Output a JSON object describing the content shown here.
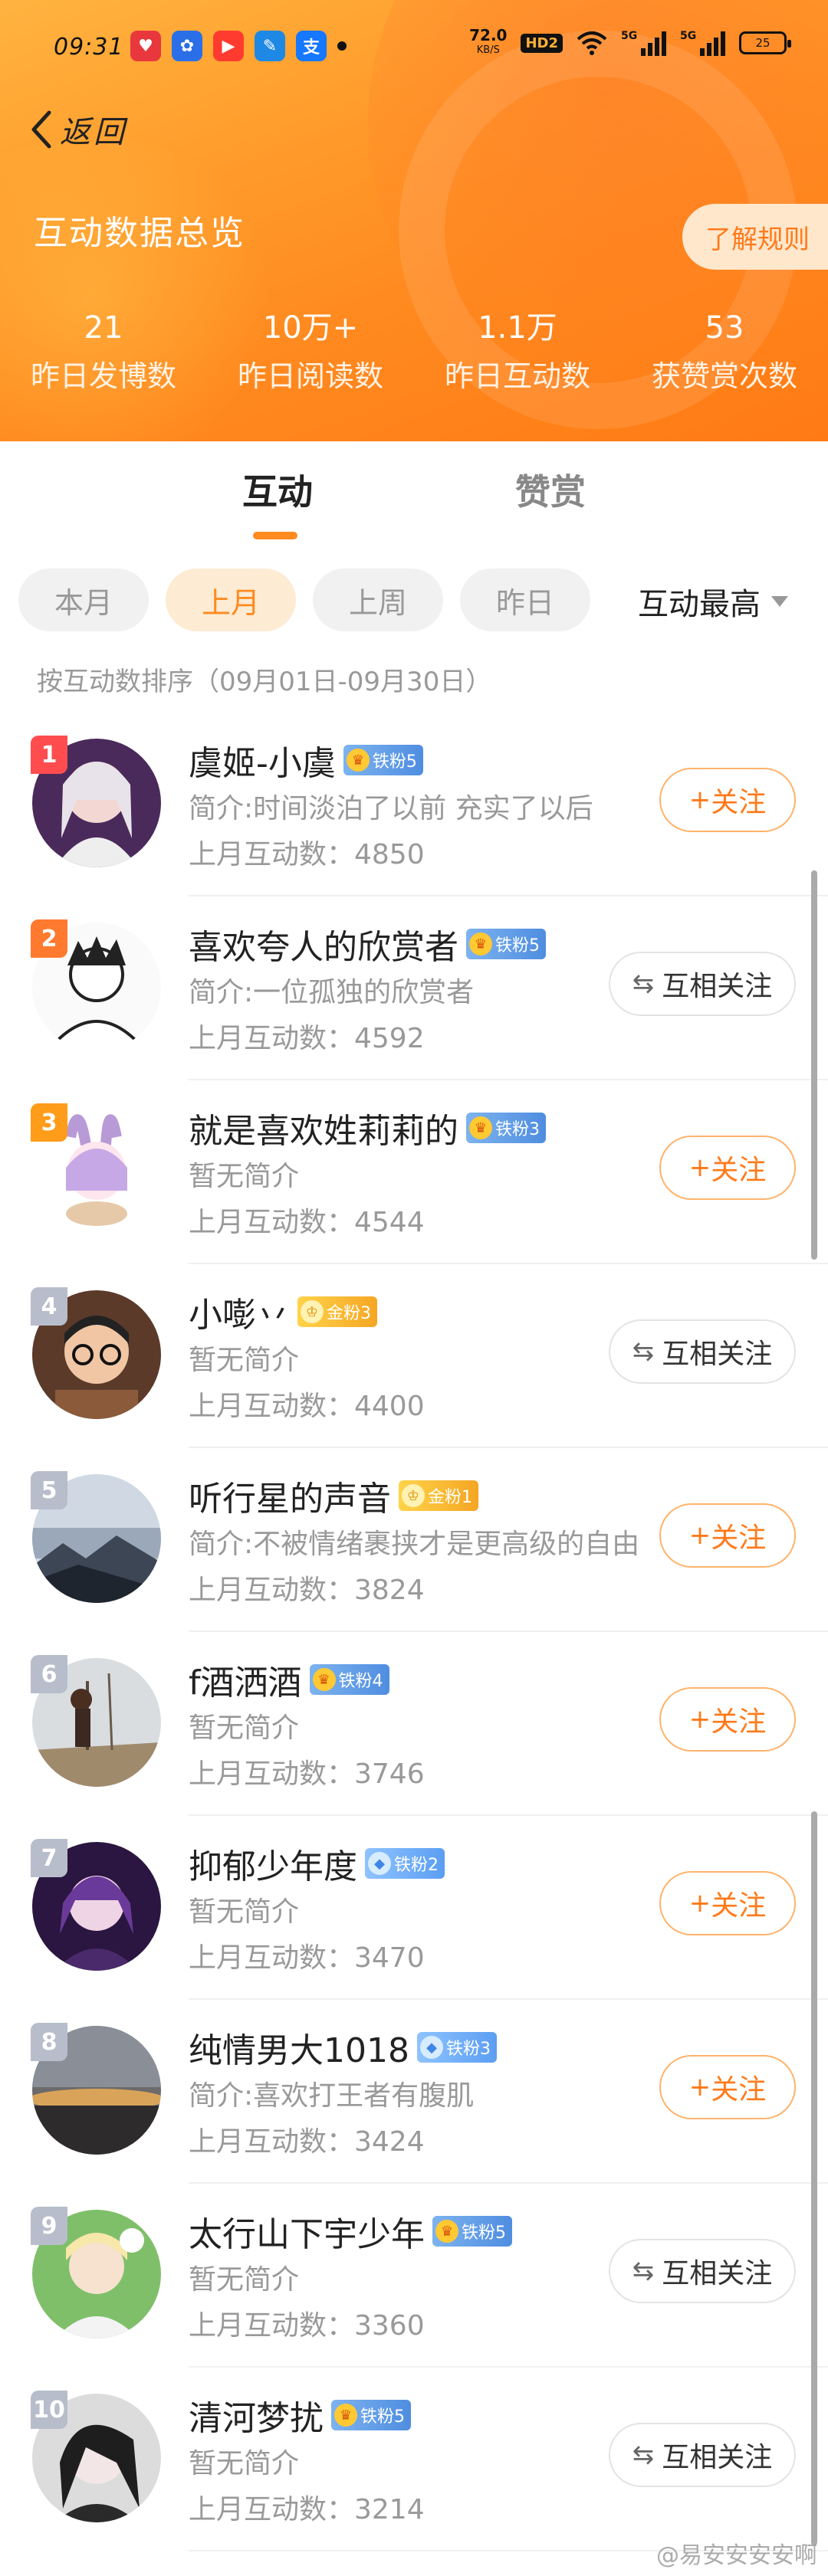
{
  "status_bar": {
    "time": "09:31",
    "network_speed": "72.0",
    "network_unit": "KB/S",
    "hd_label": "HD2",
    "signal_label": "5G",
    "battery": "25"
  },
  "header": {
    "back_label": "返回",
    "title": "互动数据总览",
    "rules_button": "了解规则",
    "stats": [
      {
        "value": "21",
        "label": "昨日发博数"
      },
      {
        "value": "10万+",
        "label": "昨日阅读数"
      },
      {
        "value": "1.1万",
        "label": "昨日互动数"
      },
      {
        "value": "53",
        "label": "获赞赏次数"
      }
    ]
  },
  "tabs": [
    {
      "label": "互动",
      "active": true
    },
    {
      "label": "赞赏",
      "active": false
    }
  ],
  "filters": {
    "chips": [
      {
        "label": "本月",
        "active": false
      },
      {
        "label": "上月",
        "active": true
      },
      {
        "label": "上周",
        "active": false
      },
      {
        "label": "昨日",
        "active": false
      }
    ],
    "sort_label": "互动最高",
    "sort_note": "按互动数排序（09月01日-09月30日）"
  },
  "users": [
    {
      "rank": "1",
      "name": "虞姬-小虞",
      "badge": "铁粉5",
      "badge_type": "iron",
      "intro": "简介:时间淡泊了以前 充实了以后",
      "count": "上月互动数：4850",
      "action": "关注",
      "action_type": "follow"
    },
    {
      "rank": "2",
      "name": "喜欢夸人的欣赏者",
      "badge": "铁粉5",
      "badge_type": "iron",
      "intro": "简介:一位孤独的欣赏者",
      "count": "上月互动数：4592",
      "action": "互相关注",
      "action_type": "mutual"
    },
    {
      "rank": "3",
      "name": "就是喜欢姓莉莉的",
      "badge": "铁粉3",
      "badge_type": "iron",
      "intro": "暂无简介",
      "count": "上月互动数：4544",
      "action": "关注",
      "action_type": "follow"
    },
    {
      "rank": "4",
      "name": "小嘭丷",
      "badge": "金粉3",
      "badge_type": "gold",
      "intro": "暂无简介",
      "count": "上月互动数：4400",
      "action": "互相关注",
      "action_type": "mutual"
    },
    {
      "rank": "5",
      "name": "听行星的声音",
      "badge": "金粉1",
      "badge_type": "gold",
      "intro": "简介:不被情绪裹挟才是更高级的自由",
      "count": "上月互动数：3824",
      "action": "关注",
      "action_type": "follow"
    },
    {
      "rank": "6",
      "name": "f酒洒酒",
      "badge": "铁粉4",
      "badge_type": "iron",
      "intro": "暂无简介",
      "count": "上月互动数：3746",
      "action": "关注",
      "action_type": "follow"
    },
    {
      "rank": "7",
      "name": "抑郁少年度",
      "badge": "铁粉2",
      "badge_type": "diamond",
      "intro": "暂无简介",
      "count": "上月互动数：3470",
      "action": "关注",
      "action_type": "follow"
    },
    {
      "rank": "8",
      "name": "纯情男大1018",
      "badge": "铁粉3",
      "badge_type": "diamond",
      "intro": "简介:喜欢打王者有腹肌",
      "count": "上月互动数：3424",
      "action": "关注",
      "action_type": "follow"
    },
    {
      "rank": "9",
      "name": "太行山下宇少年",
      "badge": "铁粉5",
      "badge_type": "iron",
      "intro": "暂无简介",
      "count": "上月互动数：3360",
      "action": "互相关注",
      "action_type": "mutual"
    },
    {
      "rank": "10",
      "name": "清河梦扰",
      "badge": "铁粉5",
      "badge_type": "iron",
      "intro": "暂无简介",
      "count": "上月互动数：3214",
      "action": "互相关注",
      "action_type": "mutual"
    }
  ],
  "watermark": "@易安安安安啊",
  "colors": {
    "accent": "#ff8a1f",
    "rank_top3": [
      "#ff4d4f",
      "#ff7a2e",
      "#ff9c1a"
    ],
    "rank_other": "#b8bdcc"
  }
}
